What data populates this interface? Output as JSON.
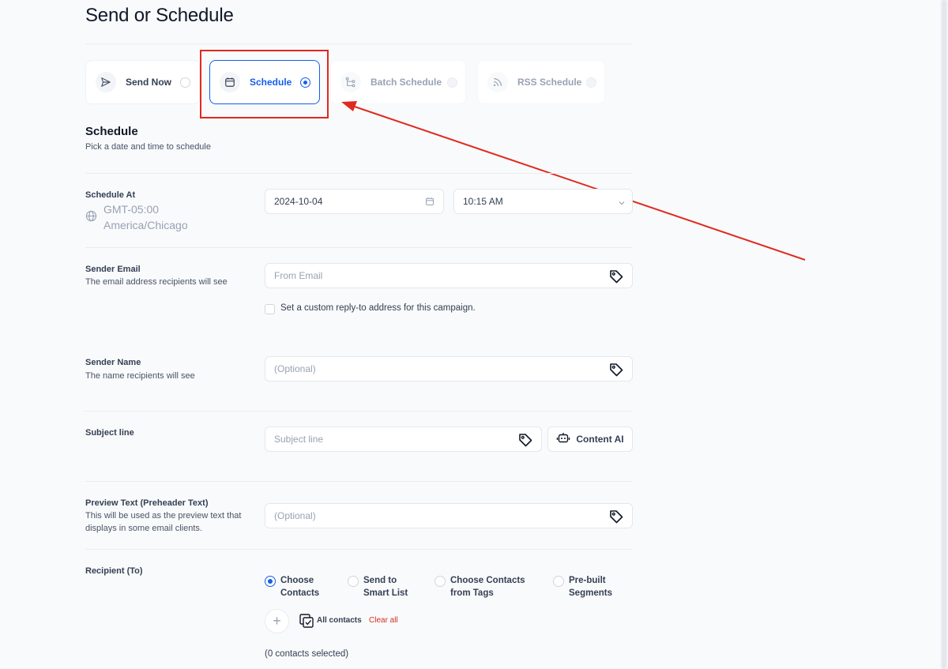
{
  "page": {
    "title": "Send or Schedule"
  },
  "modes": [
    {
      "label": "Send Now",
      "icon": "send-icon",
      "state": "default"
    },
    {
      "label": "Schedule",
      "icon": "calendar-icon",
      "state": "selected"
    },
    {
      "label": "Batch Schedule",
      "icon": "batch-icon",
      "state": "disabled"
    },
    {
      "label": "RSS Schedule",
      "icon": "rss-icon",
      "state": "disabled"
    }
  ],
  "schedule": {
    "title": "Schedule",
    "subtitle": "Pick a date and time to schedule",
    "schedule_at_label": "Schedule At",
    "timezone_offset": "GMT-05:00",
    "timezone_name": "America/Chicago",
    "date_value": "2024-10-04",
    "time_value": "10:15 AM"
  },
  "sender_email": {
    "label": "Sender Email",
    "help": "The email address recipients will see",
    "placeholder": "From Email",
    "reply_to_checkbox": "Set a custom reply-to address for this campaign."
  },
  "sender_name": {
    "label": "Sender Name",
    "help": "The name recipients will see",
    "placeholder": "(Optional)"
  },
  "subject": {
    "label": "Subject line",
    "placeholder": "Subject line",
    "content_ai_label": "Content AI"
  },
  "preview_text": {
    "label": "Preview Text (Preheader Text)",
    "help": "This will be used as the preview text that displays in some email clients.",
    "placeholder": "(Optional)"
  },
  "recipient": {
    "label": "Recipient (To)",
    "options": [
      {
        "line1": "Choose",
        "line2": "Contacts",
        "selected": true
      },
      {
        "line1": "Send to",
        "line2": "Smart List",
        "selected": false
      },
      {
        "line1": "Choose Contacts",
        "line2": "from Tags",
        "selected": false
      },
      {
        "line1": "Pre-built",
        "line2": "Segments",
        "selected": false
      }
    ],
    "all_contacts_label": "All contacts",
    "clear_all_label": "Clear all",
    "selected_count": "(0 contacts selected)"
  },
  "colors": {
    "accent": "#155eef",
    "highlight": "#e0291f",
    "danger": "#d92d20"
  }
}
